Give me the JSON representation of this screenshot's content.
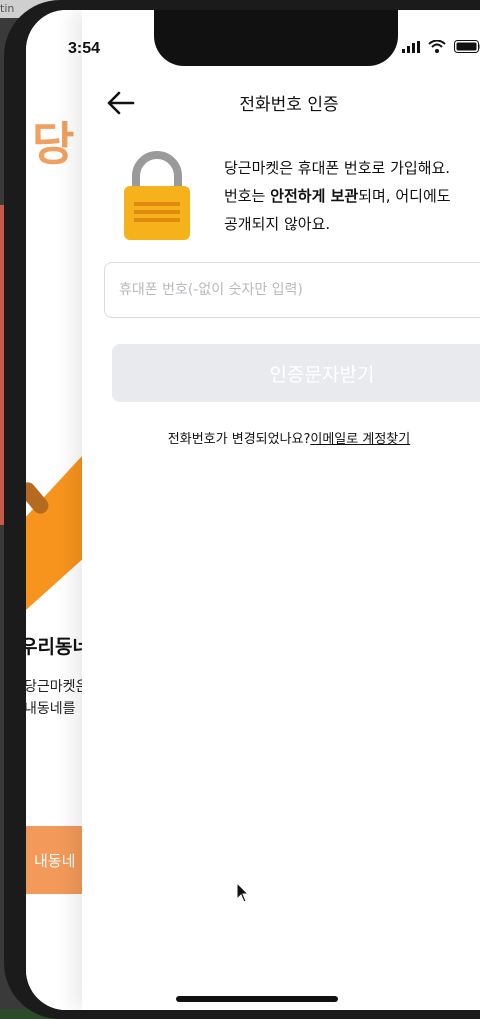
{
  "desktop": {
    "corner_text": "tin"
  },
  "status_bar": {
    "time": "3:54"
  },
  "background_screen": {
    "title_fragment": "당",
    "heading_fragment": "우리동네",
    "desc_line1_fragment": "당근마켓은",
    "desc_line2_fragment": "내동네를",
    "button_fragment": "내동네"
  },
  "nav": {
    "title": "전화번호 인증",
    "back_icon": "arrow-left-icon"
  },
  "intro": {
    "lock_icon": "lock-icon",
    "line1": "당근마켓은 휴대폰 번호로 가입해요.",
    "line2_prefix": "번호는 ",
    "line2_bold": "안전하게 보관",
    "line2_suffix": "되며, 어디에도",
    "line3": "공개되지 않아요."
  },
  "phone_field": {
    "placeholder": "휴대폰 번호(-없이 숫자만 입력)",
    "value": ""
  },
  "verify_button": {
    "label": "인증문자받기"
  },
  "help": {
    "prefix": "전화번호가 변경되었나요?",
    "link": "이메일로 계정찾기"
  },
  "colors": {
    "brand_orange": "#f39a5a",
    "disabled_button": "#e8eaee",
    "lock_gold": "#f6b21a"
  }
}
